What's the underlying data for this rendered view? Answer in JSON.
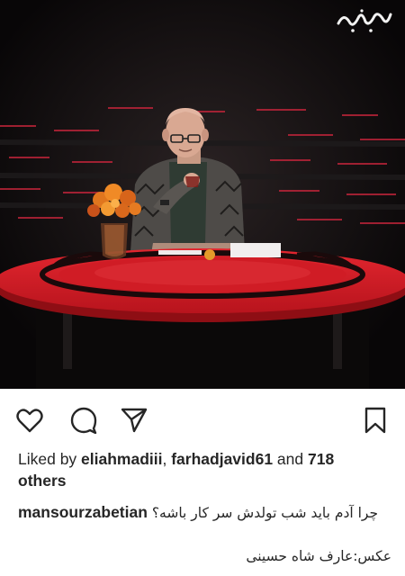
{
  "post": {
    "watermark": "برترینها",
    "photo_alt": "photo"
  },
  "actions": {
    "like": "heart-icon",
    "comment": "comment-icon",
    "share": "share-icon",
    "save": "bookmark-icon"
  },
  "likes": {
    "prefix": "Liked by ",
    "user1": "eliahmadiii",
    "separator": ", ",
    "user2": "farhadjavid61",
    "middle": " and ",
    "count": "718",
    "suffix": "others"
  },
  "caption": {
    "username": "mansourzabetian",
    "text": "چرا آدم باید شب تولدش سر کار باشه؟",
    "credit": "عکس:عارف شاه حسینی"
  },
  "colors": {
    "table_red": "#d8202a",
    "background": "#0d0b0c",
    "text": "#262626"
  }
}
